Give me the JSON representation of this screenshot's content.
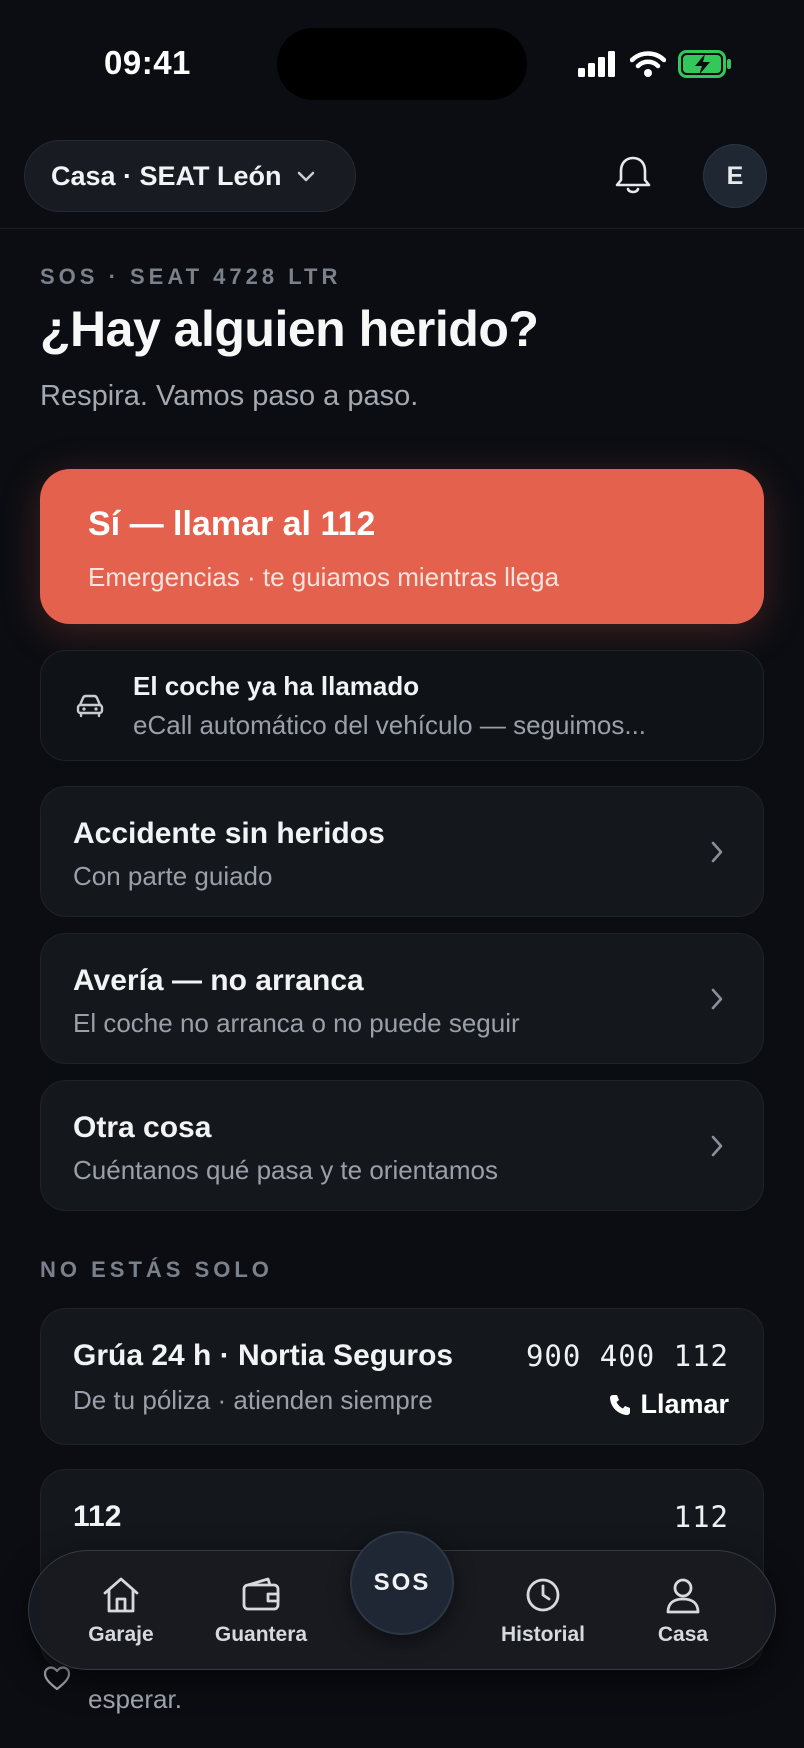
{
  "status_bar": {
    "time": "09:41"
  },
  "header": {
    "profile_label": "Casa · SEAT León",
    "avatar_initial": "E"
  },
  "intro": {
    "eyebrow": "SOS · SEAT 4728 LTR",
    "title": "¿Hay alguien herido?",
    "subtitle": "Respira. Vamos paso a paso."
  },
  "primary_action": {
    "title": "Sí — llamar al 112",
    "subtitle": "Emergencias · te guiamos mientras llega",
    "color": "#e3614d"
  },
  "ecall": {
    "title": "El coche ya ha llamado",
    "subtitle": "eCall automático del vehículo — seguimos...",
    "icon": "car-icon"
  },
  "options": [
    {
      "title": "Accidente sin heridos",
      "subtitle": "Con parte guiado"
    },
    {
      "title": "Avería — no arranca",
      "subtitle": "El coche no arranca o no puede seguir"
    },
    {
      "title": "Otra cosa",
      "subtitle": "Cuéntanos qué pasa y te orientamos"
    }
  ],
  "support": {
    "section_label": "NO ESTÁS SOLO",
    "contacts": [
      {
        "title": "Grúa 24 h · Nortia Seguros",
        "subtitle": "De tu póliza · atienden siempre",
        "number": "900 400 112",
        "call_label": "Llamar"
      },
      {
        "title": "112",
        "number": "112"
      }
    ],
    "footnote": "esperar."
  },
  "nav": {
    "items": [
      {
        "label": "Garaje",
        "icon": "house-icon"
      },
      {
        "label": "Guantera",
        "icon": "wallet-icon"
      },
      {
        "label": "Historial",
        "icon": "clock-icon"
      },
      {
        "label": "Casa",
        "icon": "person-icon"
      }
    ],
    "sos_label": "SOS"
  },
  "colors": {
    "background": "#0b0d12",
    "accent": "#e3614d",
    "battery": "#34c759"
  }
}
